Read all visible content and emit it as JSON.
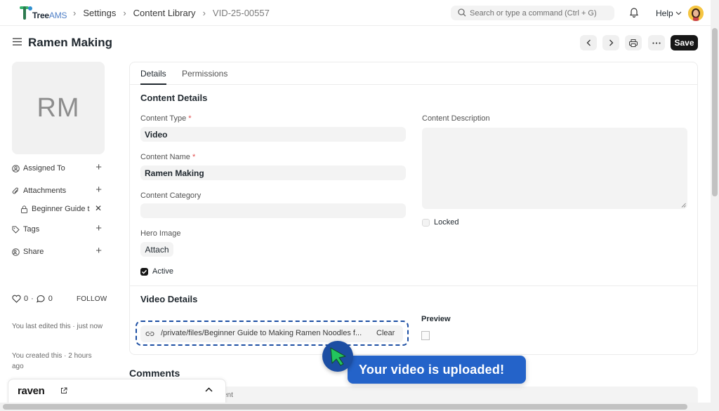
{
  "brand": {
    "name_tree": "Tree",
    "name_ams": "AMS"
  },
  "breadcrumb": [
    "Settings",
    "Content Library",
    "VID-25-00557"
  ],
  "search": {
    "placeholder": "Search or type a command (Ctrl + G)"
  },
  "navbar": {
    "help_label": "Help"
  },
  "page": {
    "title": "Ramen Making",
    "save_label": "Save"
  },
  "sidebar": {
    "avatar_initials": "RM",
    "assigned_to": "Assigned To",
    "attachments": "Attachments",
    "attachment_item": "Beginner Guide t",
    "tags": "Tags",
    "share": "Share",
    "likes": "0",
    "comments": "0",
    "follow": "FOLLOW",
    "edited_note": "You last edited this · just now",
    "created_note": "You created this · 2 hours ago"
  },
  "tabs": {
    "details": "Details",
    "permissions": "Permissions"
  },
  "content_details": {
    "section_title": "Content Details",
    "content_type_label": "Content Type",
    "content_type_value": "Video",
    "content_name_label": "Content Name",
    "content_name_value": "Ramen Making",
    "content_category_label": "Content Category",
    "content_category_value": "",
    "hero_image_label": "Hero Image",
    "attach_label": "Attach",
    "active_label": "Active",
    "description_label": "Content Description",
    "locked_label": "Locked",
    "required_mark": "*"
  },
  "video_details": {
    "section_title": "Video Details",
    "url_value": "/private/files/Beginner Guide to Making Ramen Noodles f...",
    "clear_label": "Clear",
    "preview_label": "Preview"
  },
  "comments": {
    "title": "Comments",
    "placeholder_tail": "ent"
  },
  "raven": {
    "name": "raven"
  },
  "toast": {
    "message": "Your video is uploaded!"
  },
  "colors": {
    "accent": "#2463c9",
    "highlight": "#1c4ea3",
    "cursor_green": "#22c55e"
  }
}
